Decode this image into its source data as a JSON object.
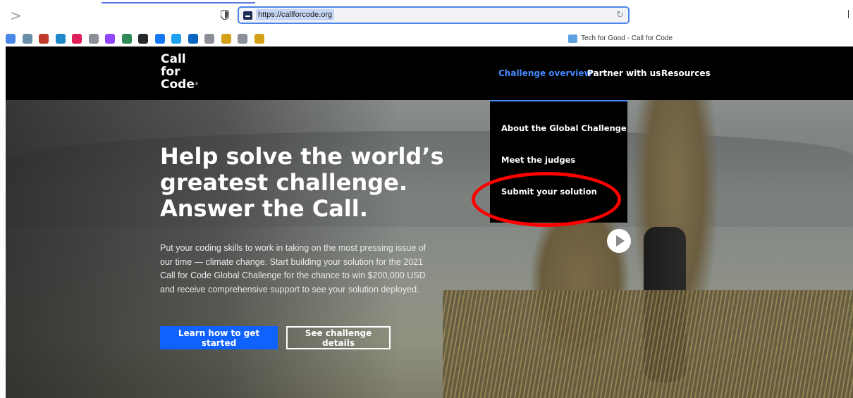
{
  "browser": {
    "url": "https://callforcode.org",
    "tab_title": "Tech for Good - Call for Code",
    "nav_glyph": ">",
    "reload_glyph": "↻"
  },
  "bookmarks": [
    {
      "icon": "bookmark-icon-1",
      "color": "#4a86e8"
    },
    {
      "icon": "bookmark-icon-2",
      "color": "#6b8fa8"
    },
    {
      "icon": "bookmark-icon-3",
      "color": "#c0392b"
    },
    {
      "icon": "bookmark-icon-4",
      "color": "#1e88c8"
    },
    {
      "icon": "slack-icon",
      "color": "#e01e5a"
    },
    {
      "icon": "bookmark-icon-6",
      "color": "#8a8f98"
    },
    {
      "icon": "twitch-icon",
      "color": "#9146ff"
    },
    {
      "icon": "bookmark-icon-8",
      "color": "#2e8b57"
    },
    {
      "icon": "github-icon",
      "color": "#24292e"
    },
    {
      "icon": "facebook-icon",
      "color": "#1877f2"
    },
    {
      "icon": "twitter-icon",
      "color": "#1da1f2"
    },
    {
      "icon": "linkedin-icon",
      "color": "#0a66c2"
    },
    {
      "icon": "bookmark-icon-13",
      "color": "#8a8f98"
    },
    {
      "icon": "bookmark-icon-14",
      "color": "#d4a017"
    },
    {
      "icon": "bookmark-icon-15",
      "color": "#8a8f98"
    },
    {
      "icon": "bookmark-icon-16",
      "color": "#d4a017"
    }
  ],
  "site": {
    "logo": {
      "line1": "Call",
      "line2": "for",
      "line3": "Code",
      "mark": "®"
    },
    "nav": [
      {
        "label": "Challenge overview",
        "active": true
      },
      {
        "label": "Partner with us",
        "active": false
      },
      {
        "label": "Resources",
        "active": false
      }
    ],
    "dropdown": [
      {
        "label": "About the Global Challenge"
      },
      {
        "label": "Meet the judges"
      },
      {
        "label": "Submit your solution"
      }
    ],
    "hero": {
      "headline_lines": [
        "Help solve the world’s",
        "greatest challenge.",
        "Answer the Call."
      ],
      "body_lines": [
        "Put your coding skills to work in taking on the most pressing issue of",
        "our time — climate change. Start building your solution for the 2021",
        "Call for Code Global Challenge for the chance to win $200,000 USD",
        "and receive comprehensive support to see your solution deployed."
      ],
      "primary_button": "Learn how to get started",
      "secondary_button": "See challenge details"
    },
    "colors": {
      "accent": "#0f62fe",
      "nav_active": "#4589ff",
      "highlight": "#ff0000"
    }
  }
}
